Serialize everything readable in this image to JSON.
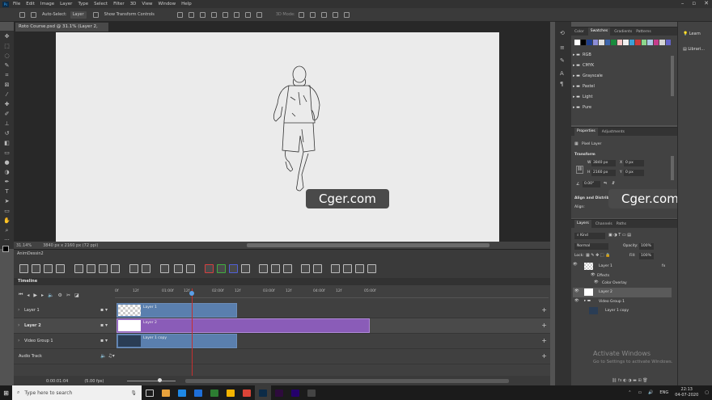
{
  "app": {
    "logo": "Ps"
  },
  "menu": [
    "File",
    "Edit",
    "Image",
    "Layer",
    "Type",
    "Select",
    "Filter",
    "3D",
    "View",
    "Window",
    "Help"
  ],
  "options_bar": {
    "auto_select": "Auto-Select:",
    "layer_select": "Layer",
    "show_transform": "Show Transform Controls",
    "mode_label": "3D Mode:"
  },
  "document_tab": {
    "title": "Roto Course.psd @ 31.1% (Layer 2, RGB/8) *"
  },
  "status": {
    "zoom": "31.14%",
    "size": "3840 px x 2160 px (72 ppi)"
  },
  "actions_panel": {
    "title": "AnimDessin2"
  },
  "timeline": {
    "title": "Timeline",
    "ruler": [
      "0f",
      "12f",
      "01:00f",
      "12f",
      "02:00f",
      "12f",
      "03:00f",
      "12f",
      "04:00f",
      "12f",
      "05:00f"
    ],
    "tracks": [
      {
        "name": "Layer 1",
        "clip": "Layer 1"
      },
      {
        "name": "Layer 2",
        "clip": "Layer 2"
      },
      {
        "name": "Video Group 1",
        "clip": "Layer 1 copy"
      },
      {
        "name": "Audio Track",
        "clip": ""
      }
    ],
    "timecode": "0:00:01:04",
    "fps": "(5.00 fps)"
  },
  "swatches_panel": {
    "tabs": [
      "Color",
      "Swatches",
      "Gradients",
      "Patterns"
    ],
    "active": "Swatches",
    "colors": [
      "#ffffff",
      "#000000",
      "#1f3f8e",
      "#8c8cd6",
      "#e0e0e0",
      "#3c64aa",
      "#1a8a3c",
      "#f6c4c4",
      "#f0f0f0",
      "#3ca0d6",
      "#cc3c3c",
      "#8cd68c",
      "#aac8e6",
      "#c43c8c",
      "#d6d6d6",
      "#6464c8"
    ],
    "groups": [
      "RGB",
      "CMYK",
      "Grayscale",
      "Pastel",
      "Light",
      "Pure"
    ]
  },
  "properties_panel": {
    "tabs": [
      "Properties",
      "Adjustments"
    ],
    "active": "Properties",
    "type": "Pixel Layer",
    "transform_label": "Transform",
    "w_label": "W",
    "w": "3840 px",
    "x_label": "X",
    "x": "0 px",
    "h_label": "H",
    "h": "2160 px",
    "y_label": "Y",
    "y": "0 px",
    "angle": "0.00°",
    "align_label": "Align and Distribute",
    "align_sub": "Align:"
  },
  "layers_panel": {
    "tabs": [
      "Layers",
      "Channels",
      "Paths"
    ],
    "active": "Layers",
    "filter": "Kind",
    "blend_mode": "Normal",
    "opacity_label": "Opacity:",
    "opacity": "100%",
    "lock_label": "Lock:",
    "fill_label": "Fill:",
    "fill": "100%",
    "layers": [
      {
        "name": "Layer 1",
        "fx": "fx"
      },
      {
        "name": "Effects"
      },
      {
        "name": "Color Overlay"
      },
      {
        "name": "Layer 2"
      },
      {
        "name": "Video Group 1"
      },
      {
        "name": "Layer 1 copy"
      }
    ]
  },
  "learn_panel": {
    "items": [
      "Learn",
      "Librari..."
    ]
  },
  "watermark": "Cger.com",
  "activation": {
    "title": "Activate Windows",
    "subtitle": "Go to Settings to activate Windows."
  },
  "taskbar": {
    "search_placeholder": "Type here to search",
    "language": "ENG",
    "time": "22:13",
    "date": "04-07-2020",
    "pinned_colors": [
      "#1e6fd9",
      "#e8a23c",
      "#1e88e5",
      "#2d7d32",
      "#f4b400",
      "#db4437",
      "#0c2b47",
      "#2d0b3c",
      "#24006b",
      "#444444"
    ]
  }
}
